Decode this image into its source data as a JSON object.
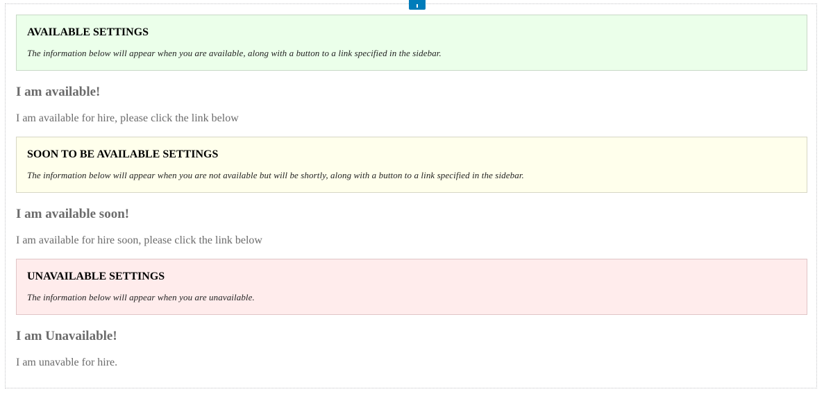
{
  "editor": {
    "add_block_icon": "plus-icon",
    "accent_color": "#007cba"
  },
  "available": {
    "title": "AVAILABLE SETTINGS",
    "description": "The information below will appear when you are available, along with a button to a link specified in the sidebar.",
    "heading": "I am available!",
    "text": "I am available for hire, please click the link below",
    "background": "#ebffea"
  },
  "soon": {
    "title": "SOON TO BE AVAILABLE SETTINGS",
    "description": "The information below will appear when you are not available but will be shortly, along with a button to a link specified in the sidebar.",
    "heading": "I am available soon!",
    "text": "I am available for hire soon, please click the link below",
    "background": "#ffffec"
  },
  "unavailable": {
    "title": "UNAVAILABLE SETTINGS",
    "description": "The information below will appear when you are unavailable.",
    "heading": "I am Unavailable!",
    "text": "I am unavable for hire.",
    "background": "#ffecec"
  }
}
